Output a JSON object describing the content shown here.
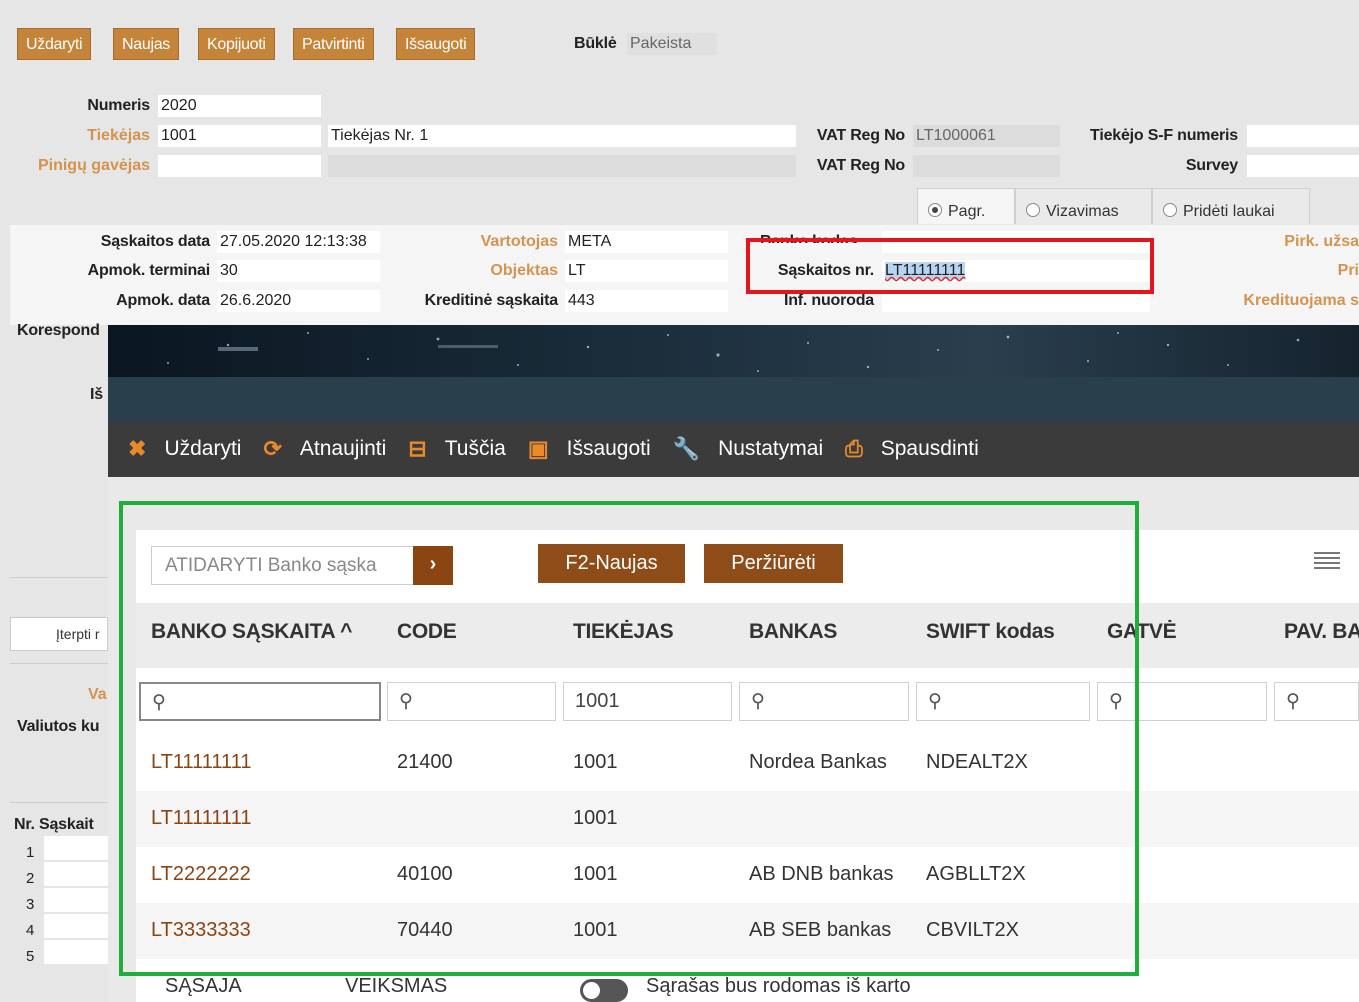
{
  "toolbar": {
    "buttons": [
      "Uždaryti",
      "Naujas",
      "Kopijuoti",
      "Patvirtinti",
      "Išsaugoti"
    ],
    "status_label": "Būklė",
    "status_value": "Pakeista"
  },
  "header": {
    "numeris_label": "Numeris",
    "numeris_value": "2020",
    "tiekejas_label": "Tiekėjas",
    "tiekejas_code": "1001",
    "tiekejas_name": "Tiekėjas Nr. 1",
    "gavejas_label": "Pinigų gavėjas",
    "vat_label": "VAT Reg No",
    "vat_value": "LT1000061",
    "vat2_label": "VAT Reg No",
    "sf_label": "Tiekėjo S-F numeris",
    "survey_label": "Survey"
  },
  "tabs": [
    "Pagr.",
    "Vizavimas",
    "Pridėti laukai"
  ],
  "form": {
    "saskaitos_data_label": "Sąskaitos data",
    "saskaitos_data_value": "27.05.2020 12:13:38",
    "terminai_label": "Apmok. terminai",
    "terminai_value": "30",
    "apmok_data_label": "Apmok. data",
    "apmok_data_value": "26.6.2020",
    "vartotojas_label": "Vartotojas",
    "vartotojas_value": "META",
    "objektas_label": "Objektas",
    "objektas_value": "LT",
    "kreditine_label": "Kreditinė sąskaita",
    "kreditine_value": "443",
    "banko_kodas_label": "Banko kodas",
    "saskaitos_nr_label": "Sąskaitos nr.",
    "saskaitos_nr_value": "LT11111111",
    "inf_label": "Inf. nuoroda",
    "pirk_label": "Pirk. užsa",
    "pri_label": "Pri",
    "kredituojama_label": "Kredituojama s",
    "korespond_label": "Korespond",
    "is_label": "Iš",
    "iterpti_label": "Įterpti r",
    "va_label": "Va",
    "valiutos_label": "Valiutos ku",
    "nr_label": "Nr.",
    "saskait_label": "Sąskait",
    "row_numbers": [
      "1",
      "2",
      "3",
      "4",
      "5"
    ]
  },
  "modal": {
    "toolbar": [
      "Uždaryti",
      "Atnaujinti",
      "Tuščia",
      "Išsaugoti",
      "Nustatymai",
      "Spausdinti"
    ],
    "search_placeholder": "ATIDARYTI Banko sąska",
    "go_label": "›",
    "new_button": "F2-Naujas",
    "view_button": "Peržiūrėti",
    "columns": [
      "BANKO SĄSKAITA ^",
      "CODE",
      "TIEKĖJAS",
      "BANKAS",
      "SWIFT kodas",
      "GATVĖ",
      "PAV. BA"
    ],
    "filter_tiekejas": "1001",
    "rows": [
      {
        "account": "LT11111111",
        "code": "21400",
        "tiekejas": "1001",
        "bankas": "Nordea Bankas",
        "swift": "NDEALT2X"
      },
      {
        "account": "LT11111111",
        "code": "",
        "tiekejas": "1001",
        "bankas": "",
        "swift": ""
      },
      {
        "account": "LT2222222",
        "code": "40100",
        "tiekejas": "1001",
        "bankas": "AB DNB bankas",
        "swift": "AGBLLT2X"
      },
      {
        "account": "LT3333333",
        "code": "70440",
        "tiekejas": "1001",
        "bankas": "AB SEB bankas",
        "swift": "CBVILT2X"
      }
    ],
    "footer": {
      "left": "SĄSAJA",
      "mid": "VEIKSMAS",
      "toggle_text": "Sąrašas bus rodomas iš karto"
    }
  },
  "colors": {
    "accent": "#c4843a",
    "highlight_red": "#e3161d",
    "highlight_green": "#1fae3a"
  }
}
